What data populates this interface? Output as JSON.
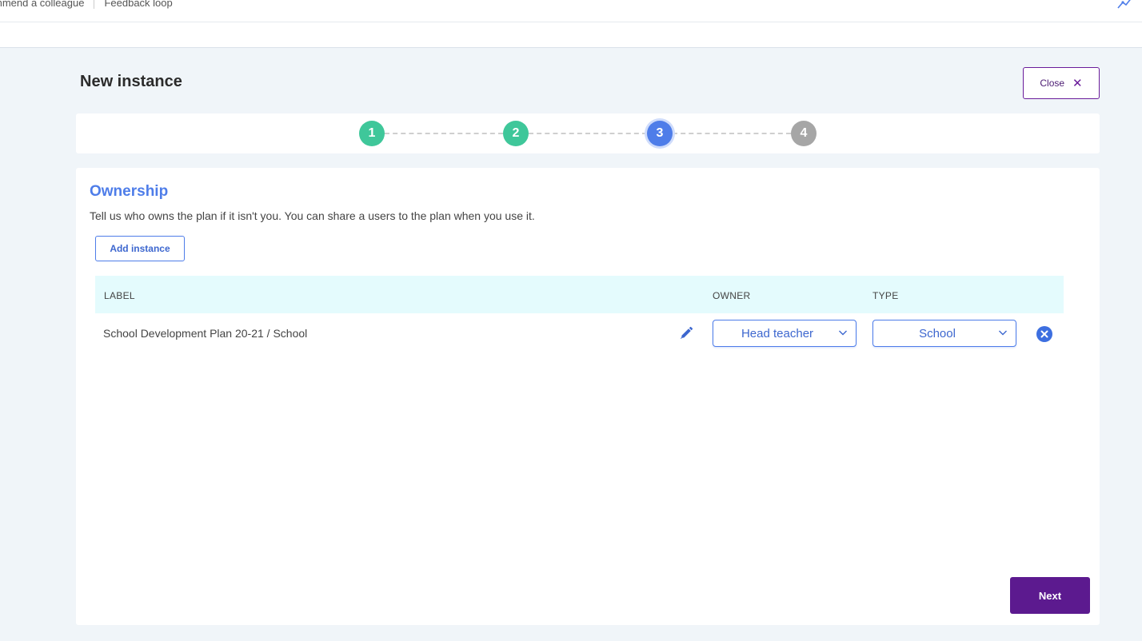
{
  "topbar": {
    "links": [
      "mmend a colleague",
      "Feedback loop"
    ],
    "tool_icon": "pen-tool-icon"
  },
  "page": {
    "title": "New instance",
    "close_label": "Close",
    "close_icon": "close-icon"
  },
  "stepper": {
    "steps": [
      {
        "label": "1",
        "state": "done"
      },
      {
        "label": "2",
        "state": "done"
      },
      {
        "label": "3",
        "state": "active"
      },
      {
        "label": "4",
        "state": "todo"
      }
    ]
  },
  "ownership": {
    "title": "Ownership",
    "description": "Tell us who owns the plan if it isn't you. You can share a users to the plan when you use it.",
    "add_button": "Add instance",
    "table": {
      "columns": [
        "LABEL",
        "OWNER",
        "TYPE"
      ],
      "rows": [
        {
          "label": "School Development Plan 20-21 / School",
          "owner": "Head teacher",
          "type": "School"
        }
      ]
    },
    "next_button": "Next"
  },
  "colors": {
    "accent_blue": "#4e7de9",
    "brand_purple": "#5c1a8f",
    "step_done": "#3fc79a",
    "step_todo": "#a6a6a6",
    "table_header_bg": "#e4fbfd"
  }
}
